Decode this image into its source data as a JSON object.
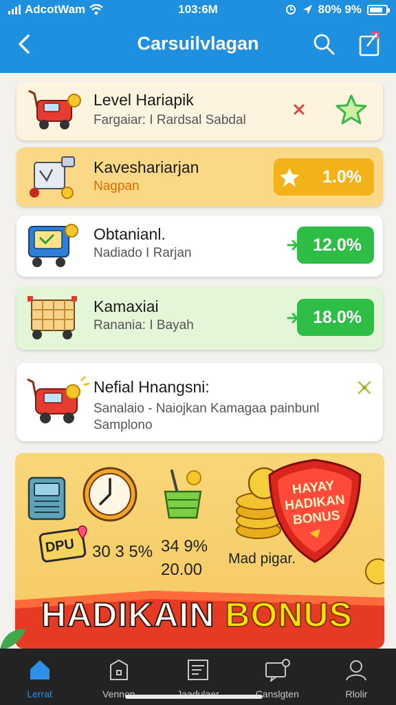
{
  "status_bar": {
    "carrier": "AdcotWam",
    "time": "103:6M",
    "battery": "80% 9%"
  },
  "header": {
    "title": "Carsuilvlagan"
  },
  "cards": [
    {
      "title": "Level Hariapik",
      "subtitle": "Fargaiar: I Rardsal Sabdal",
      "icon": "x-mark-icon"
    },
    {
      "title": "Kaveshariarjan",
      "subtitle": "Nagpan",
      "value": "1.0%"
    },
    {
      "title": "Obtanianl.",
      "subtitle": "Nadiado I Rarjan",
      "value": "12.0%"
    },
    {
      "title": "Kamaxiai",
      "subtitle": "Ranania: I Bayah",
      "value": "18.0%"
    },
    {
      "title": "Nefial Hnangsni:",
      "subtitle_line1": "Sanalaio - Naiojkan Kamagaa painbunl",
      "subtitle_line2": "Samplono"
    }
  ],
  "bonus": {
    "stat_1": "30 3 5%",
    "stat_2": "34 9%",
    "stat_2_sub": "20.00",
    "stat_3": "Mad pigar.",
    "badge_text": "HAYAY HADIKAN BONUS",
    "badge_line1": "HAYAY",
    "badge_line2": "HADIKAN",
    "badge_line3": "BONUS",
    "ribbon_word1": "HADIKAIN",
    "ribbon_word2": "BONUS",
    "ticket_text": "DPU"
  },
  "nav": [
    {
      "label": "Lerrat",
      "icon": "home-icon",
      "active": true
    },
    {
      "label": "Vennon",
      "icon": "package-icon",
      "active": false
    },
    {
      "label": "Jaadulaer",
      "icon": "document-icon",
      "active": false
    },
    {
      "label": "Canslgten",
      "icon": "chat-icon",
      "active": false
    },
    {
      "label": "Rlolir",
      "icon": "profile-icon",
      "active": false
    }
  ],
  "colors": {
    "header": "#1f8fe0",
    "green": "#2ebd45",
    "orange": "#f2b218",
    "nav_active": "#2f8fe8"
  }
}
